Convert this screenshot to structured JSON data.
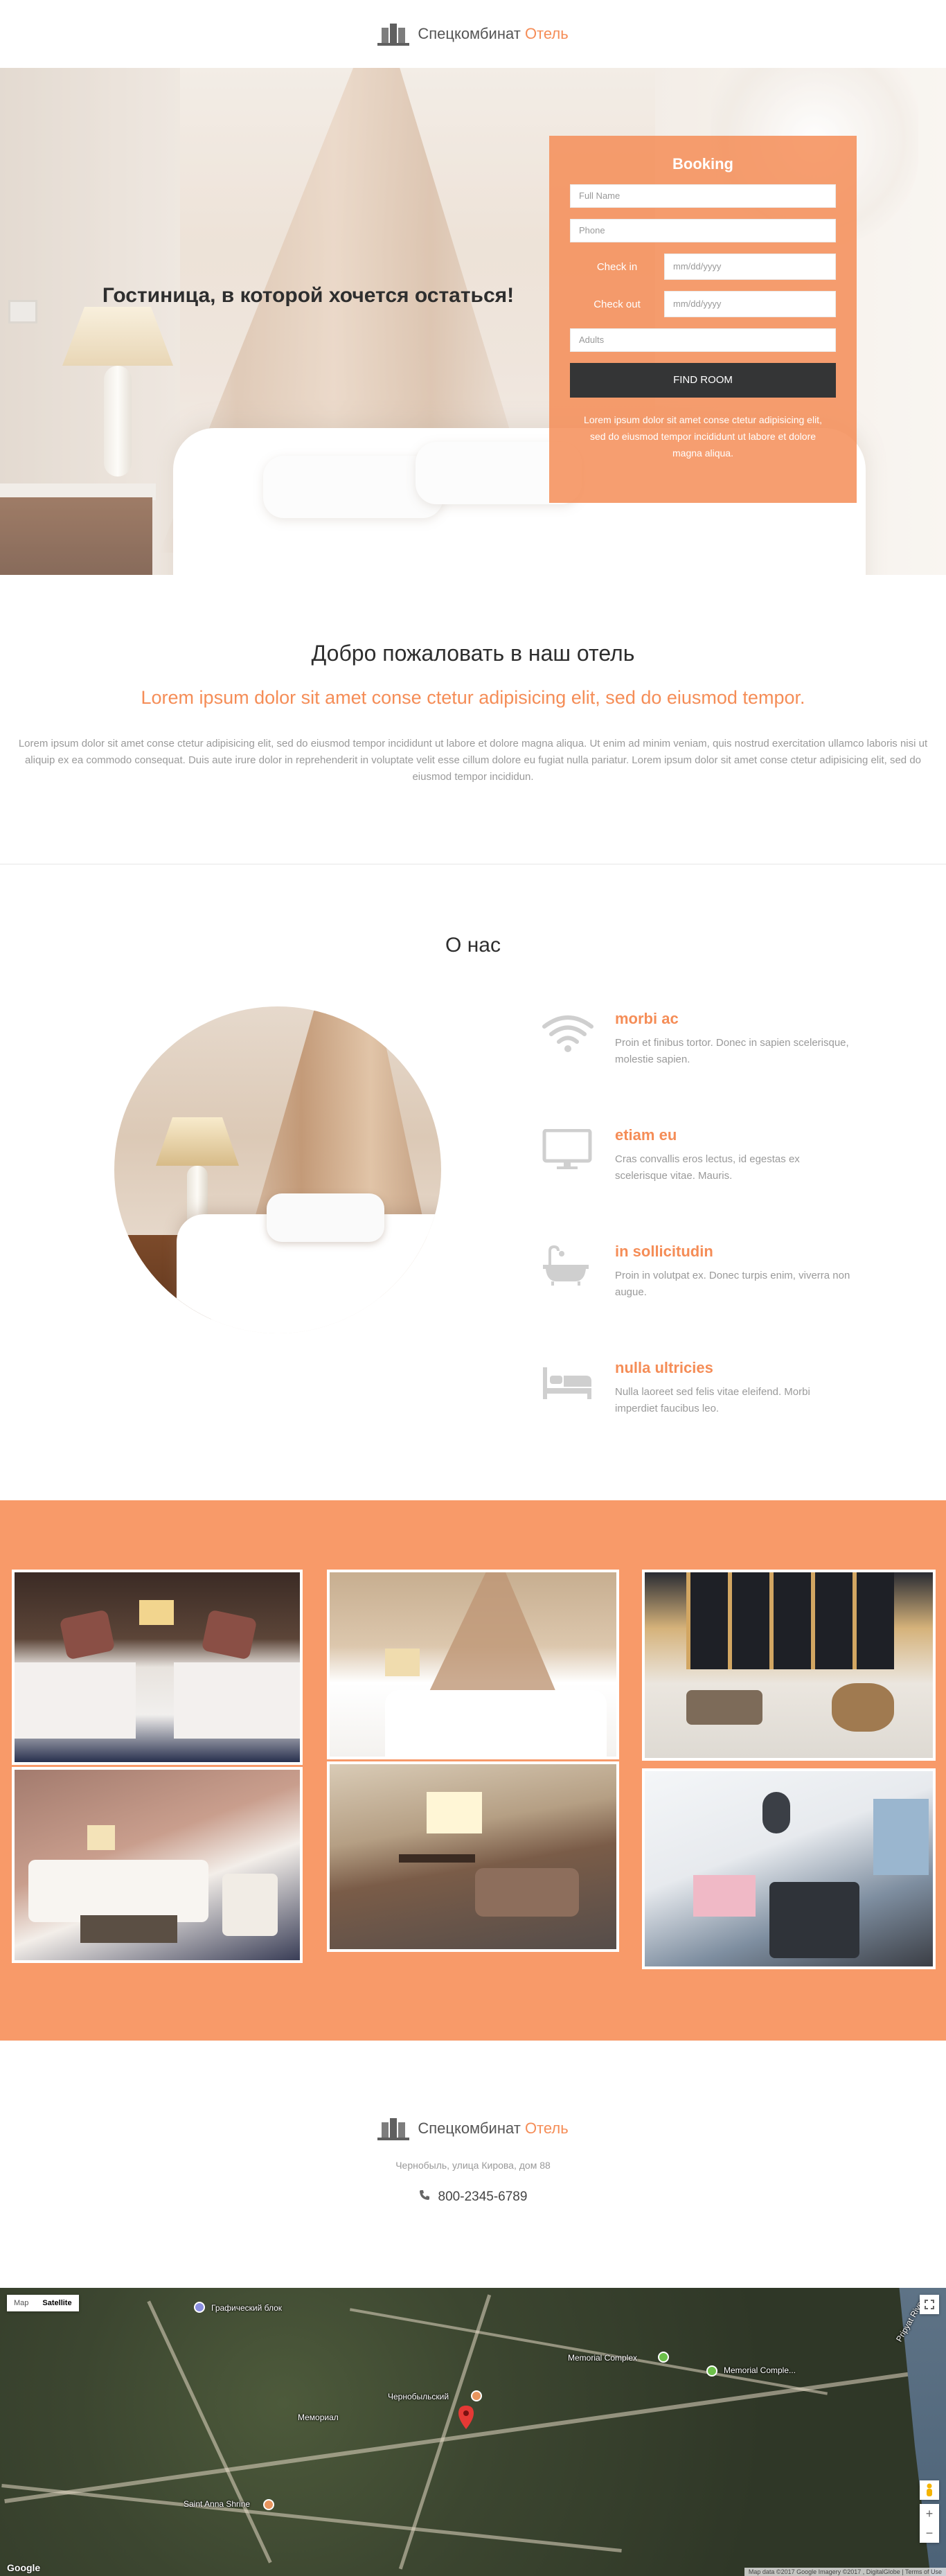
{
  "colors": {
    "accent": "#f58d57",
    "gallery_bg": "#f89a69",
    "dark_button": "#343536"
  },
  "header": {
    "logo_icon": "building-icon",
    "logo_main": "Спецкомбинат",
    "logo_accent": "Отель"
  },
  "hero": {
    "title": "Гостиница, в которой хочется остаться!",
    "booking": {
      "title": "Booking",
      "full_name_placeholder": "Full Name",
      "phone_placeholder": "Phone",
      "check_in_label": "Check in",
      "check_in_placeholder": "mm/dd/yyyy",
      "check_out_label": "Check out",
      "check_out_placeholder": "mm/dd/yyyy",
      "adults_placeholder": "Adults",
      "button": "FIND ROOM",
      "note": "Lorem ipsum dolor sit amet conse ctetur adipisicing elit, sed do eiusmod tempor incididunt ut labore et dolore magna aliqua."
    }
  },
  "welcome": {
    "title": "Добро пожаловать в наш отель",
    "subtitle": "Lorem ipsum dolor sit amet conse ctetur adipisicing elit, sed do eiusmod tempor.",
    "text": "Lorem ipsum dolor sit amet conse ctetur adipisicing elit, sed do eiusmod tempor incididunt ut labore et dolore magna aliqua. Ut enim ad minim veniam, quis nostrud exercitation ullamco laboris nisi ut aliquip ex ea commodo consequat. Duis aute irure dolor in reprehenderit in voluptate velit esse cillum dolore eu fugiat nulla pariatur. Lorem ipsum dolor sit amet conse ctetur adipisicing elit, sed do eiusmod tempor incididun."
  },
  "about": {
    "title": "О нас",
    "features": [
      {
        "icon": "wifi-icon",
        "title": "morbi ac",
        "text": "Proin et finibus tortor. Donec in sapien scelerisque, molestie sapien."
      },
      {
        "icon": "monitor-icon",
        "title": "etiam eu",
        "text": "Cras convallis eros lectus, id egestas ex scelerisque vitae. Mauris."
      },
      {
        "icon": "bathtub-icon",
        "title": "in sollicitudin",
        "text": "Proin in volutpat ex. Donec turpis enim, viverra non augue."
      },
      {
        "icon": "bed-icon",
        "title": "nulla ultricies",
        "text": "Nulla laoreet sed felis vitae eleifend. Morbi imperdiet faucibus leo."
      }
    ]
  },
  "footer": {
    "logo_main": "Спецкомбинат",
    "logo_accent": "Отель",
    "address": "Чернобыль, улица Кирова, дом 88",
    "phone_icon": "phone-icon",
    "phone": "800-2345-6789"
  },
  "map": {
    "type_map": "Map",
    "type_satellite": "Satellite",
    "labels": {
      "l1": "Графический блок",
      "l2": "Memorial Complex",
      "l3": "Memorial Comple...",
      "l4": "Мемориал",
      "l5": "Чернобыльский",
      "l6": "Pripyat River",
      "l7": "Saint Anna Shrine"
    },
    "google": "Google",
    "attribution": "Map data ©2017 Google Imagery ©2017 , DigitalGlobe | Terms of Use"
  }
}
